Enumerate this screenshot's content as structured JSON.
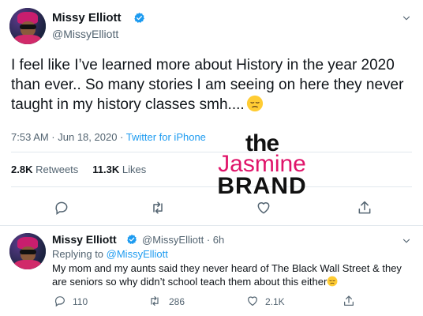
{
  "main_tweet": {
    "display_name": "Missy Elliott",
    "handle": "@MissyElliott",
    "text": "I feel like I’ve learned more about History in the year 2020 than ever.. So many stories I am seeing on here they never taught in my history classes smh....",
    "emoji": "pensive-face",
    "timestamp": "7:53 AM · Jun 18, 2020 · ",
    "source": "Twitter for iPhone",
    "retweets_count": "2.8K",
    "retweets_label": "Retweets",
    "likes_count": "11.3K",
    "likes_label": "Likes"
  },
  "watermark": {
    "the": "the",
    "jasmine": "Jasmine",
    "brand": "BRAND"
  },
  "reply_tweet": {
    "display_name": "Missy Elliott",
    "handle_time": "@MissyElliott · 6h",
    "replying_prefix": "Replying to ",
    "replying_to": "@MissyElliott",
    "text": "My mom and my aunts said they never heard of The Black Wall Street & they are seniors so why didn’t school teach them about this either",
    "emoji": "pensive-face",
    "reply_count": "110",
    "retweet_count": "286",
    "like_count": "2.1K"
  },
  "colors": {
    "accent": "#1d9bf0",
    "text_secondary": "#536471",
    "watermark_pink": "#e0146a"
  }
}
